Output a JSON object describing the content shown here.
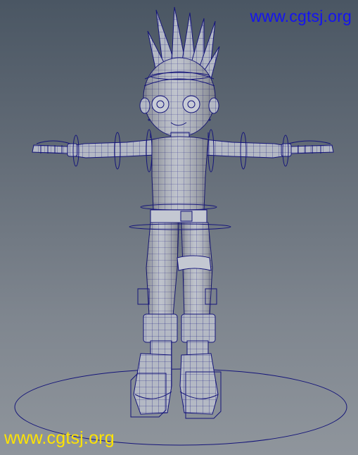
{
  "viewport": {
    "background_top": "#4a5663",
    "background_bottom": "#8f959c",
    "wireframe_color": "#15157a",
    "mesh_fill": "#b4b9c4",
    "subject_icon": "character-model-tpose"
  },
  "watermarks": {
    "top_text": "www.cgtsj.org",
    "top_color": "#1414f0",
    "bottom_text": "www.cgtsj.org",
    "bottom_color": "#ffe400"
  }
}
